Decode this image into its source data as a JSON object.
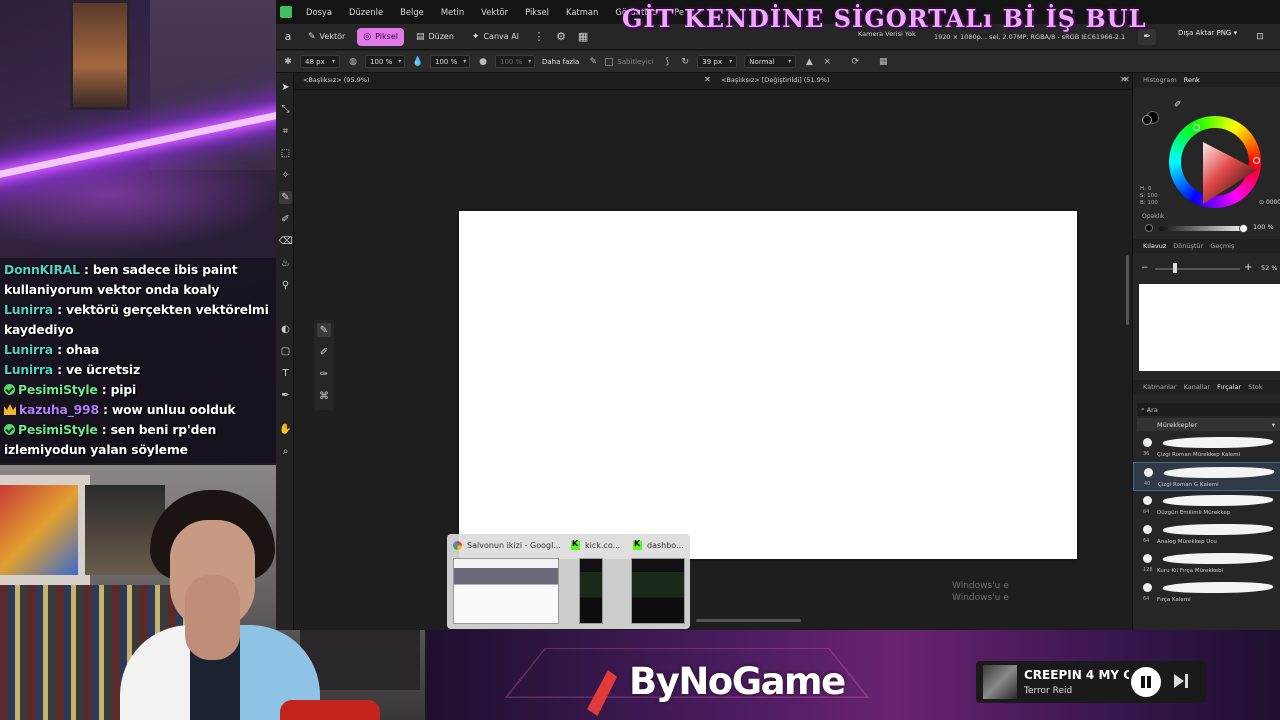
{
  "overlay": {
    "title": "GİT KENDİNE SİGORTALı Bİ İŞ BUL"
  },
  "chat": [
    {
      "user": "DonnKIRAL",
      "color": "teal",
      "badge": "",
      "text": " : ben sadece ibis paint kullaniyorum vektor onda koaly"
    },
    {
      "user": "Lunirra",
      "color": "teal",
      "badge": "",
      "text": " : vektörü gerçekten vektörelmi kaydediyo"
    },
    {
      "user": "Lunirra",
      "color": "teal",
      "badge": "",
      "text": " : ohaa"
    },
    {
      "user": "Lunirra",
      "color": "teal",
      "badge": "",
      "text": " : ve ücretsiz"
    },
    {
      "user": "PesimiStyle",
      "color": "green",
      "badge": "check",
      "text": " : pipi"
    },
    {
      "user": "kazuha_998",
      "color": "purple",
      "badge": "crown",
      "text": " : wow unluu oolduk"
    },
    {
      "user": "PesimiStyle",
      "color": "green",
      "badge": "check",
      "text": " : sen beni rp'den izlemiyodun yalan söyleme"
    }
  ],
  "menu": [
    "Dosya",
    "Düzenle",
    "Belge",
    "Metin",
    "Vektör",
    "Piksel",
    "Katman",
    "Görüntüle",
    "Pe"
  ],
  "personas": [
    {
      "label": "Vektör",
      "icon": "✎"
    },
    {
      "label": "Piksel",
      "icon": "◎",
      "active": true
    },
    {
      "label": "Düzen",
      "icon": "▤"
    },
    {
      "label": "Canva AI",
      "icon": "✦"
    }
  ],
  "docinfo": {
    "camera": "Kamera Verisi Yok",
    "specs": "1920 × 1080p... sel, 2.07MP, RGBA/8 - sRGB IEC61966-2.1",
    "export": "Dışa Aktar PNG"
  },
  "context_toolbar": {
    "size": "48 px",
    "opacity": "100 %",
    "flow": "100 %",
    "hardness": "100 %",
    "more": "Daha fazla",
    "stabilizer": "Sabitleyici",
    "width": "39 px",
    "blend": "Normal"
  },
  "doc_tabs": [
    "<Başlıksız> (95.9%)",
    "<Başlıksız> [Değiştirildi] (51.9%)"
  ],
  "panels": {
    "color_tabs": [
      "Histogram",
      "Renk"
    ],
    "hsv": [
      "H: 0",
      "S: 100",
      "B: 100"
    ],
    "hex": "000000",
    "opacity_label": "Opaklık",
    "opacity_value": "100 %",
    "nav_tabs": [
      "Kılavuz",
      "Dönüştür",
      "Geçmiş"
    ],
    "zoom": "52 %",
    "brush_tabs": [
      "Katmanlar",
      "Kanallar",
      "Fırçalar",
      "Stok"
    ],
    "search_placeholder": "Ara",
    "category": "Mürekkepler",
    "brushes": [
      {
        "size": "36",
        "name": "Çizgi Roman Mürekkep Kalemi"
      },
      {
        "size": "40",
        "name": "Çizgi Roman G Kalemi",
        "selected": true
      },
      {
        "size": "64",
        "name": "Düzgün Emilimli Mürekkep"
      },
      {
        "size": "64",
        "name": "Analog Mürekkep Ucu"
      },
      {
        "size": "128",
        "name": "Kuru Kıl Fırça Mürekkebi"
      },
      {
        "size": "64",
        "name": "Fırça Kalemi"
      }
    ]
  },
  "windows_watermark": [
    "Windows'u e",
    "Windows'u e"
  ],
  "taskbar": [
    {
      "title": "Salvonun ikizi - Googl...",
      "icon": "google"
    },
    {
      "title": "kick.co...",
      "icon": "kick"
    },
    {
      "title": "dashbo...",
      "icon": "kick"
    }
  ],
  "banner": {
    "brand": "ByNoGame"
  },
  "player": {
    "song": "CREEPIN 4 MY C",
    "artist": "Terror Reid"
  }
}
